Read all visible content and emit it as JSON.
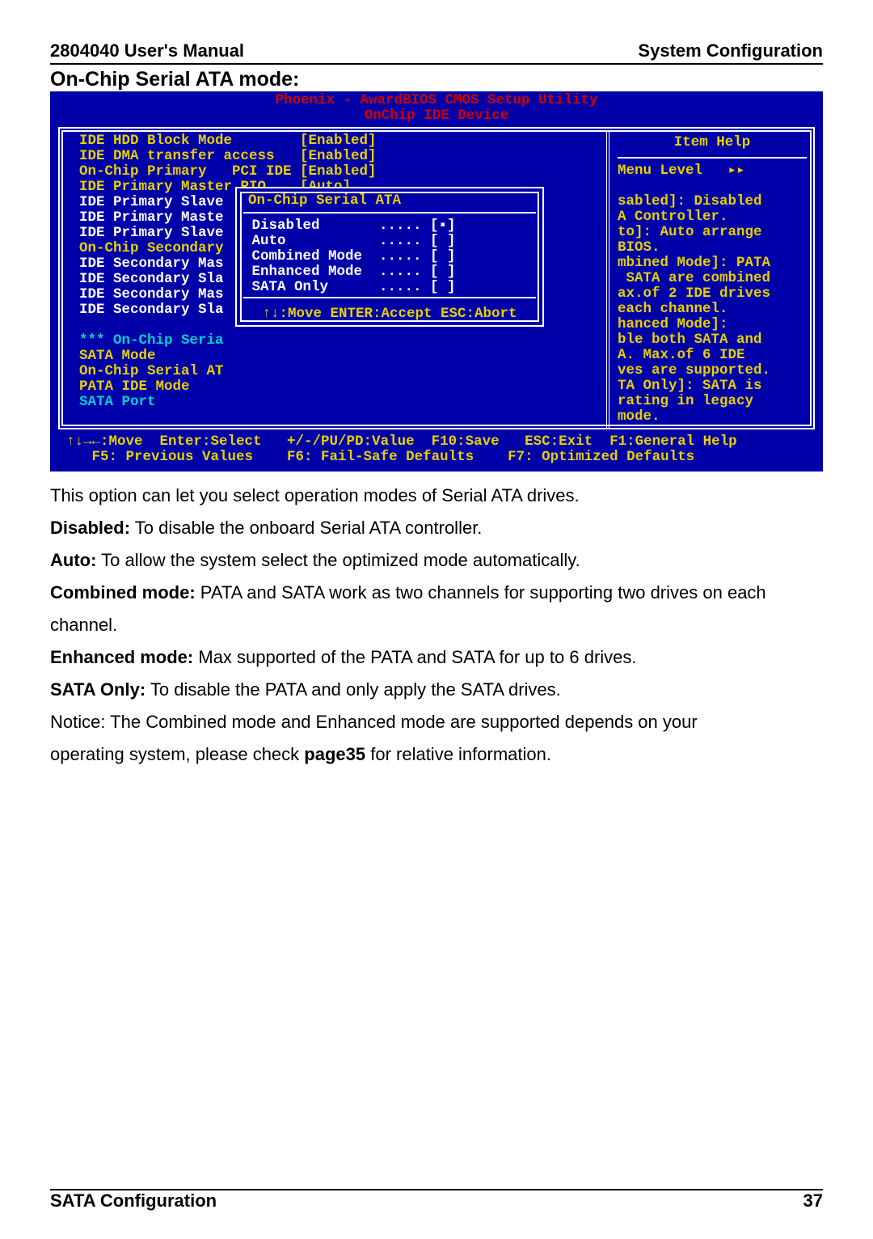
{
  "header": {
    "left": "2804040 User's Manual",
    "right": "System Configuration"
  },
  "section": "On-Chip Serial ATA mode:",
  "bios": {
    "title": "Phoenix - AwardBIOS CMOS Setup Utility",
    "subtitle": "OnChip IDE Device",
    "left": [
      {
        "label": "IDE HDD Block Mode",
        "value": "[Enabled]",
        "cls": "yel"
      },
      {
        "label": "IDE DMA transfer access",
        "value": "[Enabled]",
        "cls": "yel"
      },
      {
        "label": "On-Chip Primary   PCI IDE",
        "value": "[Enabled]",
        "cls": "yel"
      },
      {
        "label": "IDE Primary Master PIO",
        "value": "[Auto]",
        "cls": "yel"
      },
      {
        "label": "IDE Primary Slave",
        "value": "",
        "cls": ""
      },
      {
        "label": "IDE Primary Maste",
        "value": "",
        "cls": ""
      },
      {
        "label": "IDE Primary Slave",
        "value": "",
        "cls": ""
      },
      {
        "label": "On-Chip Secondary",
        "value": "",
        "cls": "yel"
      },
      {
        "label": "IDE Secondary Mas",
        "value": "",
        "cls": ""
      },
      {
        "label": "IDE Secondary Sla",
        "value": "",
        "cls": ""
      },
      {
        "label": "IDE Secondary Mas",
        "value": "",
        "cls": ""
      },
      {
        "label": "IDE Secondary Sla",
        "value": "",
        "cls": ""
      },
      {
        "label": "",
        "value": "",
        "cls": ""
      },
      {
        "label": "*** On-Chip Seria",
        "value": "",
        "cls": "cyan"
      },
      {
        "label": "SATA Mode",
        "value": "",
        "cls": "yel"
      },
      {
        "label": "On-Chip Serial AT",
        "value": "",
        "cls": "yel"
      },
      {
        "label": "PATA IDE Mode",
        "value": "",
        "cls": "yel"
      },
      {
        "label": "SATA Port",
        "value": "",
        "cls": "cyan"
      }
    ],
    "help": {
      "title": "Item Help",
      "menu": "Menu Level   ▸▸",
      "lines": [
        "sabled]: Disabled",
        "A Controller.",
        "to]: Auto arrange",
        "BIOS.",
        "mbined Mode]: PATA",
        " SATA are combined",
        "ax.of 2 IDE drives",
        "each channel.",
        "hanced Mode]:",
        "ble both SATA and",
        "A. Max.of 6 IDE",
        "ves are supported.",
        "TA Only]: SATA is",
        "rating in legacy",
        "mode."
      ]
    },
    "popup": {
      "title": "On-Chip Serial ATA",
      "options": [
        {
          "label": "Disabled",
          "sel": true
        },
        {
          "label": "Auto",
          "sel": false
        },
        {
          "label": "Combined Mode",
          "sel": false
        },
        {
          "label": "Enhanced Mode",
          "sel": false
        },
        {
          "label": "SATA Only",
          "sel": false
        }
      ],
      "foot": "↑↓:Move ENTER:Accept ESC:Abort"
    },
    "footer": {
      "l1": "↑↓→←:Move  Enter:Select   +/-/PU/PD:Value  F10:Save   ESC:Exit  F1:General Help",
      "l2": "   F5: Previous Values    F6: Fail-Safe Defaults    F7: Optimized Defaults"
    }
  },
  "body": {
    "p1": "This option can let you select operation modes of Serial ATA drives.",
    "p2a": "Disabled:",
    "p2b": " To disable the onboard Serial ATA controller.",
    "p3a": "Auto:",
    "p3b": " To allow the system select the optimized mode automatically.",
    "p4a": "Combined mode:",
    "p4b": " PATA and SATA work as two channels for supporting two drives on each",
    "p4c": "channel.",
    "p5a": "Enhanced mode:",
    "p5b": " Max supported of the PATA and SATA for up to 6 drives.",
    "p6a": "SATA Only:",
    "p6b": " To disable the PATA and only apply the SATA drives.",
    "p7a": "Notice: The Combined mode and Enhanced mode are supported depends on your",
    "p7b": "operating system, please check ",
    "p7c": "page35",
    "p7d": " for relative information."
  },
  "footer": {
    "left": "SATA Configuration",
    "right": "37"
  }
}
